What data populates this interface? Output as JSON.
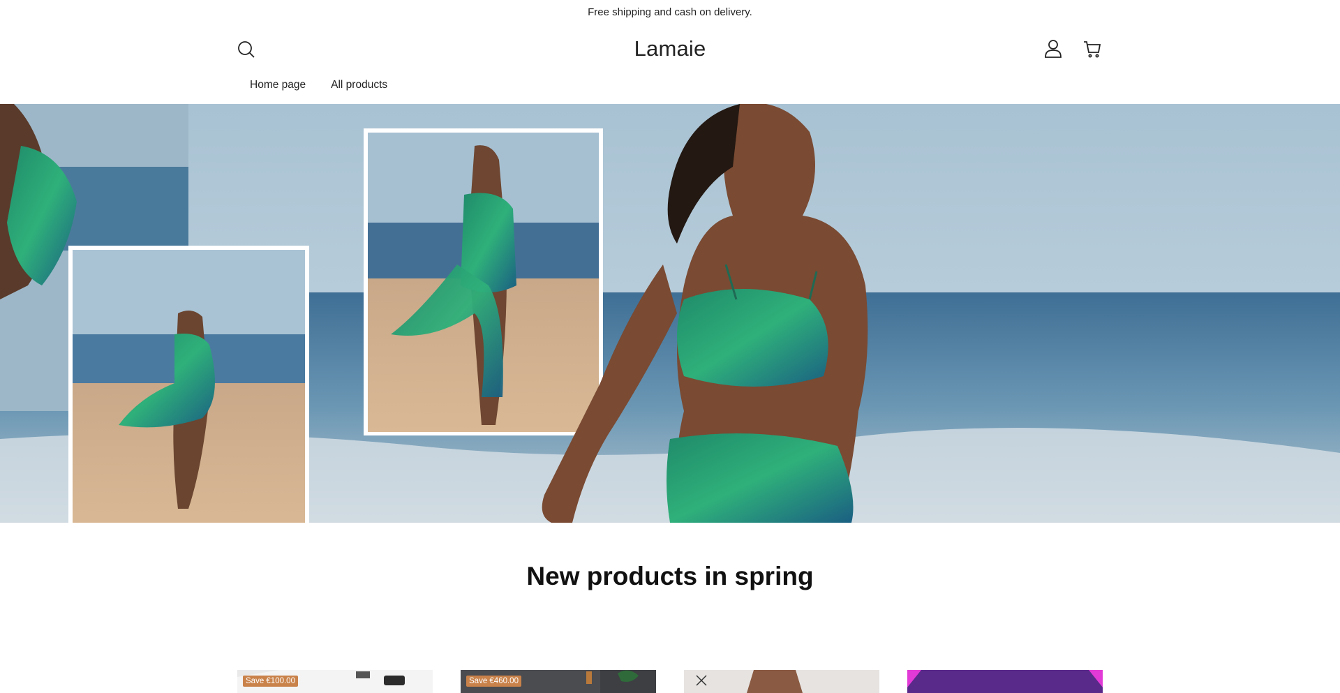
{
  "announcement": {
    "text": "Free shipping and cash on delivery."
  },
  "header": {
    "logo": "Lamaie",
    "icons": {
      "search": "search-icon",
      "account": "account-icon",
      "cart": "cart-icon"
    }
  },
  "nav": {
    "items": [
      {
        "label": "Home page"
      },
      {
        "label": "All products"
      }
    ]
  },
  "hero": {
    "image": "beach-fashion-banner"
  },
  "section": {
    "title": "New products in spring"
  },
  "products": [
    {
      "badge": "Save €100.00"
    },
    {
      "badge": "Save €460.00"
    },
    {
      "badge": ""
    },
    {
      "badge": ""
    }
  ],
  "colors": {
    "badge": "#c9824a",
    "text": "#222222"
  }
}
